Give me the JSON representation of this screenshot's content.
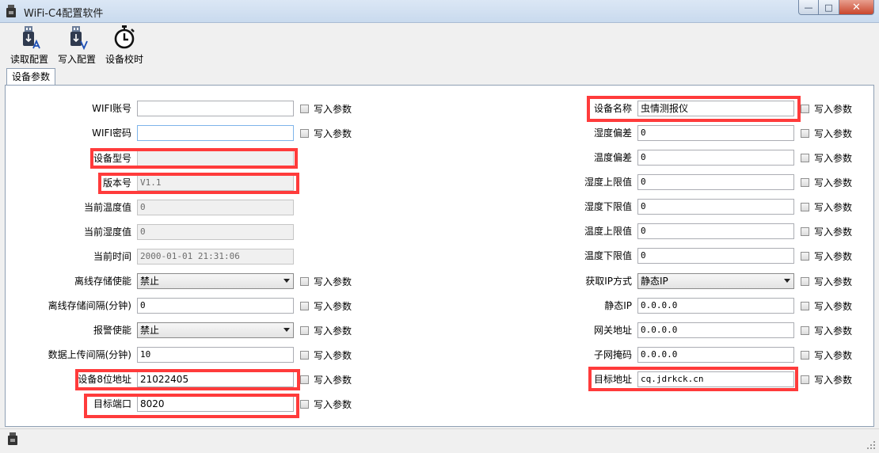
{
  "window": {
    "title": "WiFi-C4配置软件"
  },
  "toolbar": {
    "read_label": "读取配置",
    "write_label": "写入配置",
    "time_label": "设备校时"
  },
  "tabs": {
    "active": "设备参数"
  },
  "checkbox_label": "写入参数",
  "left": {
    "wifi_ssid": {
      "label": "WIFI账号",
      "value": ""
    },
    "wifi_pwd": {
      "label": "WIFI密码",
      "value": ""
    },
    "device_model": {
      "label": "设备型号",
      "value": ""
    },
    "version": {
      "label": "版本号",
      "value": "V1.1"
    },
    "cur_temp": {
      "label": "当前温度值",
      "value": "0"
    },
    "cur_hum": {
      "label": "当前湿度值",
      "value": "0"
    },
    "cur_time": {
      "label": "当前时间",
      "value": "2000-01-01 21:31:06"
    },
    "offline_enable": {
      "label": "离线存储使能",
      "value": "禁止"
    },
    "offline_interval": {
      "label": "离线存储间隔(分钟)",
      "value": "0"
    },
    "alarm_enable": {
      "label": "报警使能",
      "value": "禁止"
    },
    "upload_interval": {
      "label": "数据上传间隔(分钟)",
      "value": "10"
    },
    "device_addr": {
      "label": "设备8位地址",
      "value": "21022405"
    },
    "target_port": {
      "label": "目标端口",
      "value": "8020"
    }
  },
  "right": {
    "device_name": {
      "label": "设备名称",
      "value": "虫情测报仪"
    },
    "hum_offset": {
      "label": "湿度偏差",
      "value": "0"
    },
    "temp_offset": {
      "label": "温度偏差",
      "value": "0"
    },
    "hum_upper": {
      "label": "湿度上限值",
      "value": "0"
    },
    "hum_lower": {
      "label": "湿度下限值",
      "value": "0"
    },
    "temp_upper": {
      "label": "温度上限值",
      "value": "0"
    },
    "temp_lower": {
      "label": "温度下限值",
      "value": "0"
    },
    "ip_mode": {
      "label": "获取IP方式",
      "value": "静态IP"
    },
    "static_ip": {
      "label": "静态IP",
      "value": "0.0.0.0"
    },
    "gateway": {
      "label": "网关地址",
      "value": "0.0.0.0"
    },
    "subnet": {
      "label": "子网掩码",
      "value": "0.0.0.0"
    },
    "target_addr": {
      "label": "目标地址",
      "value": "cq.jdrkck.cn"
    }
  },
  "colors": {
    "highlight": "#ff3b3b",
    "panel_bg": "#ffffff",
    "window_bg": "#f0f0f0"
  }
}
